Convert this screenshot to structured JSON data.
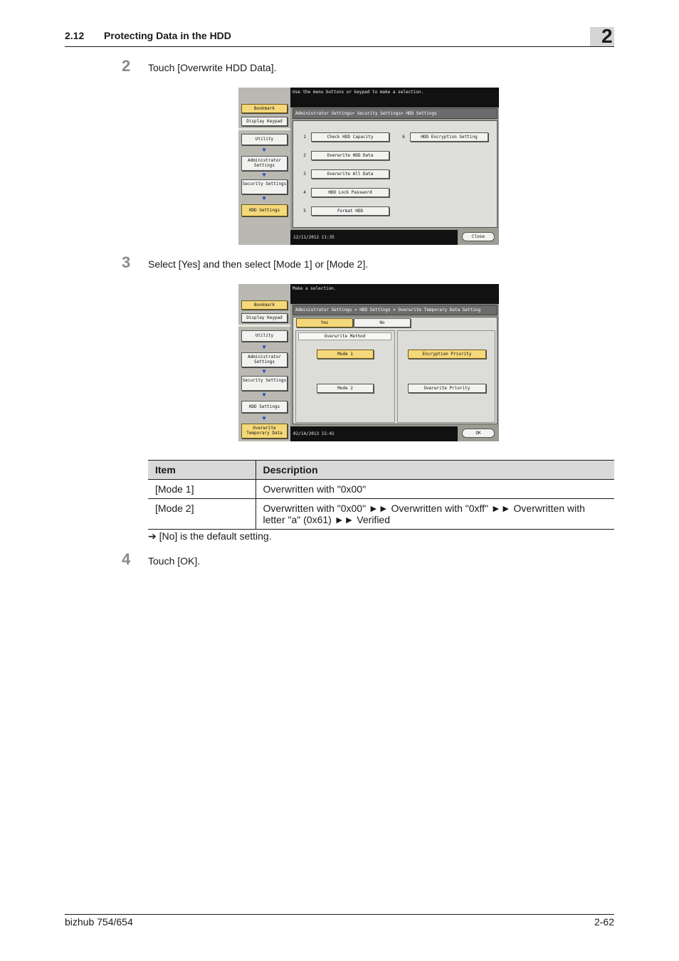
{
  "header": {
    "section_number": "2.12",
    "section_title": "Protecting Data in the HDD",
    "chapter": "2"
  },
  "steps": [
    {
      "number": "2",
      "text": "Touch [Overwrite HDD Data]."
    },
    {
      "number": "3",
      "text": "Select [Yes] and then select [Mode 1] or [Mode 2]."
    },
    {
      "number": "4",
      "text": "Touch [OK]."
    }
  ],
  "screen1": {
    "message": "Use the menu buttons or keypad to make a selection.",
    "breadcrumb": "Administrator Settings> Security Settings> HDD Settings",
    "sidebar": {
      "bookmark": "Bookmark",
      "display_keypad": "Display Keypad",
      "utility": "Utility",
      "admin_settings": "Administrator Settings",
      "security_settings": "Security Settings",
      "hdd_settings": "HDD Settings"
    },
    "menu": [
      {
        "index": "1",
        "label": "Check HDD Capacity"
      },
      {
        "index": "2",
        "label": "Overwrite HDD Data"
      },
      {
        "index": "3",
        "label": "Overwrite All Data"
      },
      {
        "index": "4",
        "label": "HDD Lock Password"
      },
      {
        "index": "5",
        "label": "Format HDD"
      },
      {
        "index": "6",
        "label": "HDD Encryption Setting"
      }
    ],
    "datetime": "12/11/2012    11:35",
    "close_label": "Close"
  },
  "screen2": {
    "message": "Make a selection.",
    "breadcrumb": "Administrator Settings > HDD Settings > Overwrite Temporary Data Setting",
    "sidebar": {
      "bookmark": "Bookmark",
      "display_keypad": "Display Keypad",
      "utility": "Utility",
      "admin_settings": "Administrator Settings",
      "security_settings": "Security Settings",
      "hdd_settings": "HDD Settings",
      "overwrite_temp": "Overwrite Temporary Data"
    },
    "yes_label": "Yes",
    "no_label": "No",
    "overwrite_method_label": "Overwrite Method",
    "mode1_label": "Mode 1",
    "mode2_label": "Mode 2",
    "encryption_priority_label": "Encryption Priority",
    "overwrite_priority_label": "Overwrite Priority",
    "datetime": "02/14/2013    15:41",
    "ok_label": "OK"
  },
  "table": {
    "headers": [
      "Item",
      "Description"
    ],
    "rows": [
      {
        "item": "[Mode 1]",
        "description": "Overwritten with \"0x00\""
      },
      {
        "item": "[Mode 2]",
        "description": "Overwritten with \"0x00\" ►► Overwritten with \"0xff\" ►► Overwritten with letter \"a\" (0x61) ►► Verified"
      }
    ]
  },
  "note": "➔  [No] is the default setting.",
  "footer": {
    "left": "bizhub 754/654",
    "right": "2-62"
  }
}
